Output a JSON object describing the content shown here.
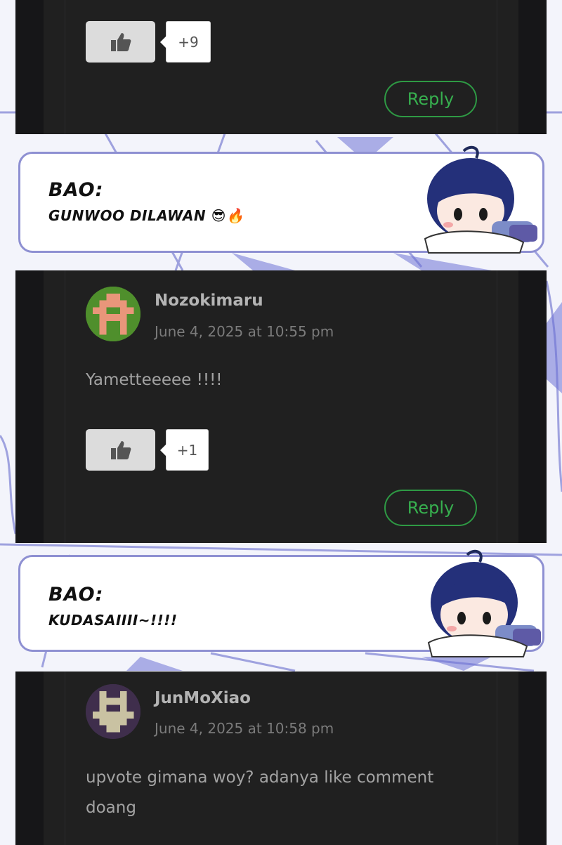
{
  "comments": [
    {
      "likes": "+9",
      "reply_label": "Reply"
    },
    {
      "username": "Nozokimaru",
      "timestamp": "June 4, 2025 at 10:55 pm",
      "text": "Yametteeeee !!!!",
      "likes": "+1",
      "reply_label": "Reply"
    },
    {
      "username": "JunMoXiao",
      "timestamp": "June 4, 2025 at 10:58 pm",
      "text_line1": "upvote gimana woy? adanya like comment",
      "text_line2": "doang"
    }
  ],
  "bubbles": [
    {
      "speaker": "BAO:",
      "text": "GUNWOO DILAWAN 😎🔥"
    },
    {
      "speaker": "BAO:",
      "text": "KUDASAIIII~!!!!"
    }
  ],
  "colors": {
    "panel": "#202020",
    "reply_green": "#37b04f",
    "bubble_border": "#8e90d2"
  },
  "icons": [
    "thumbs-up-icon",
    "pixel-avatar-icon",
    "chibi-character"
  ]
}
